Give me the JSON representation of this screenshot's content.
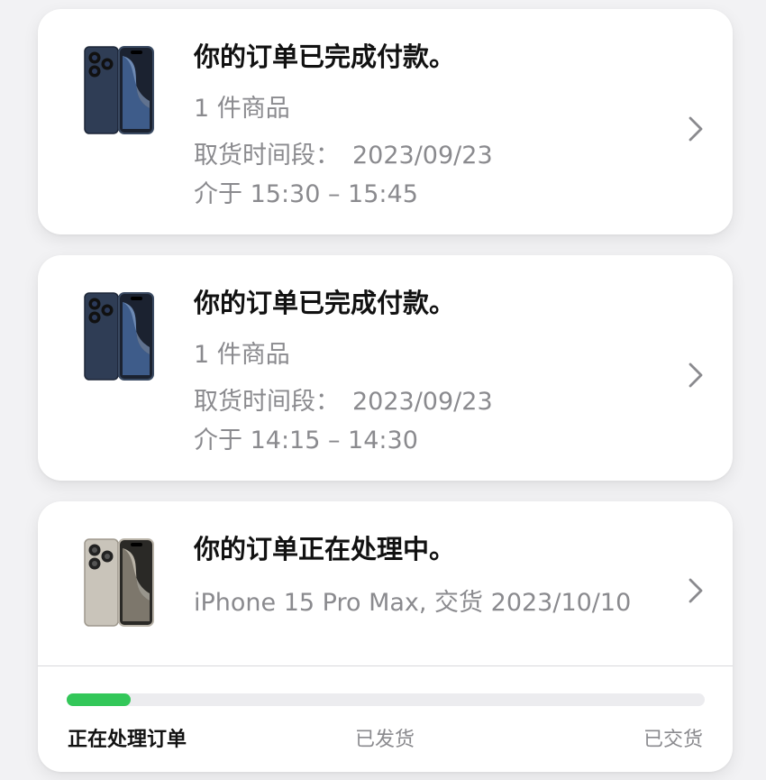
{
  "orders": [
    {
      "status": "你的订单已完成付款。",
      "item_count": "1 件商品",
      "pickup_label": "取货时间段：",
      "pickup_date": "2023/09/23",
      "pickup_window": "介于 15:30 – 15:45",
      "product_color": "#3a4a62",
      "icons": [
        "iphone-blue-titanium-icon",
        "chevron-right-icon"
      ]
    },
    {
      "status": "你的订单已完成付款。",
      "item_count": "1 件商品",
      "pickup_label": "取货时间段：",
      "pickup_date": "2023/09/23",
      "pickup_window": "介于 14:15 – 14:30",
      "product_color": "#3a4a62",
      "icons": [
        "iphone-blue-titanium-icon",
        "chevron-right-icon"
      ]
    },
    {
      "status": "你的订单正在处理中。",
      "detail": "iPhone 15 Pro Max, 交货 2023/10/10",
      "product_color": "#b9b3a8",
      "icons": [
        "iphone-natural-titanium-icon",
        "chevron-right-icon"
      ],
      "progress": {
        "fraction": 0.1,
        "steps": [
          "正在处理订单",
          "已发货",
          "已交货"
        ],
        "active_step": 0,
        "fill_color": "#33c759"
      }
    }
  ]
}
